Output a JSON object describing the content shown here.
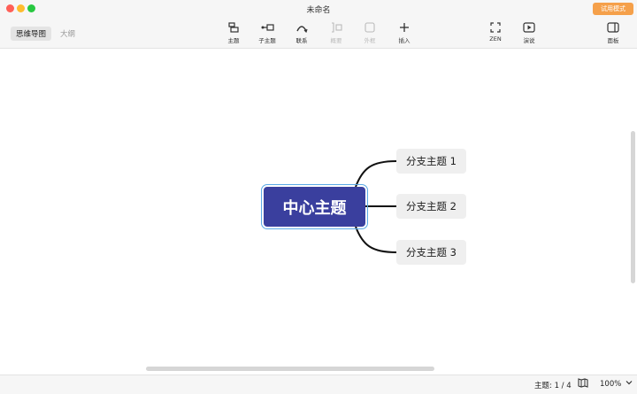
{
  "window": {
    "title": "未命名",
    "trial_label": "试用模式"
  },
  "view_tabs": [
    {
      "label": "思维导图"
    },
    {
      "label": "大纲"
    }
  ],
  "toolbar": {
    "topic": "主题",
    "subtopic": "子主题",
    "relation": "联系",
    "summary": "概要",
    "boundary": "外框",
    "insert": "插入",
    "zen": "ZEN",
    "present": "演说",
    "panel": "面板"
  },
  "mindmap": {
    "central": "中心主题",
    "branches": [
      "分支主题 1",
      "分支主题 2",
      "分支主题 3"
    ]
  },
  "status": {
    "topic_count": "主题: 1 / 4",
    "zoom": "100%"
  },
  "colors": {
    "central_fill": "#3a3f9e",
    "selection": "#5aa9e6",
    "branch_fill": "#efefef",
    "trial_badge": "#f5a04a"
  }
}
